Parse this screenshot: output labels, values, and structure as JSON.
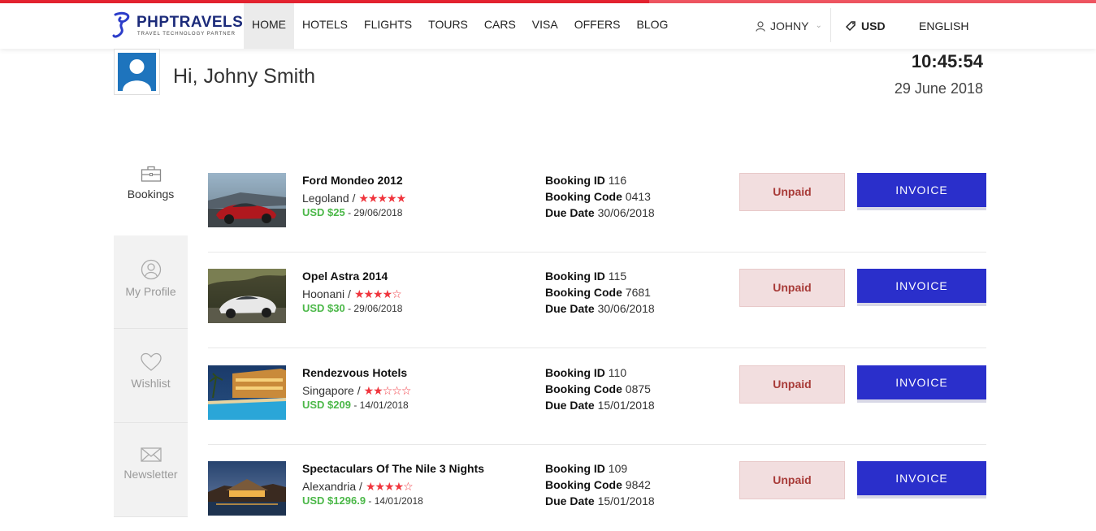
{
  "brand": {
    "name": "PHPTRAVELS",
    "tagline": "TRAVEL TECHNOLOGY PARTNER",
    "accent_color": "#e42330",
    "primary_color": "#2a2fcb"
  },
  "nav": {
    "items": [
      {
        "label": "HOME",
        "active": true
      },
      {
        "label": "HOTELS"
      },
      {
        "label": "FLIGHTS"
      },
      {
        "label": "TOURS"
      },
      {
        "label": "CARS"
      },
      {
        "label": "VISA"
      },
      {
        "label": "OFFERS"
      },
      {
        "label": "BLOG"
      }
    ]
  },
  "user_menu": {
    "label": "JOHNY",
    "icon": "user-icon"
  },
  "currency": {
    "label": "USD",
    "icon": "tag-icon"
  },
  "language": {
    "label": "ENGLISH",
    "icon": "us-flag-icon"
  },
  "profile": {
    "greeting": "Hi, Johny Smith",
    "time": "10:45:54",
    "date": "29 June 2018"
  },
  "sidebar": {
    "items": [
      {
        "label": "Bookings",
        "icon": "briefcase-icon",
        "active": true
      },
      {
        "label": "My Profile",
        "icon": "user-circle-icon"
      },
      {
        "label": "Wishlist",
        "icon": "heart-icon"
      },
      {
        "label": "Newsletter",
        "icon": "envelope-icon"
      }
    ]
  },
  "bookings": [
    {
      "title": "Ford Mondeo 2012",
      "location": "Legoland /",
      "stars": "★★★★★",
      "price": "USD $25",
      "date": "- 29/06/2018",
      "booking_id_label": "Booking ID",
      "booking_id": "116",
      "booking_code_label": "Booking Code",
      "booking_code": "0413",
      "due_date_label": "Due Date",
      "due_date": "30/06/2018",
      "status": "Unpaid",
      "action": "INVOICE"
    },
    {
      "title": "Opel Astra 2014",
      "location": "Hoonani /",
      "stars": "★★★★☆",
      "price": "USD $30",
      "date": "- 29/06/2018",
      "booking_id_label": "Booking ID",
      "booking_id": "115",
      "booking_code_label": "Booking Code",
      "booking_code": "7681",
      "due_date_label": "Due Date",
      "due_date": "30/06/2018",
      "status": "Unpaid",
      "action": "INVOICE"
    },
    {
      "title": "Rendezvous Hotels",
      "location": "Singapore /",
      "stars": "★★☆☆☆",
      "price": "USD $209",
      "date": "- 14/01/2018",
      "booking_id_label": "Booking ID",
      "booking_id": "110",
      "booking_code_label": "Booking Code",
      "booking_code": "0875",
      "due_date_label": "Due Date",
      "due_date": "15/01/2018",
      "status": "Unpaid",
      "action": "INVOICE"
    },
    {
      "title": "Spectaculars Of The Nile 3 Nights",
      "location": "Alexandria /",
      "stars": "★★★★☆",
      "price": "USD $1296.9",
      "date": "- 14/01/2018",
      "booking_id_label": "Booking ID",
      "booking_id": "109",
      "booking_code_label": "Booking Code",
      "booking_code": "9842",
      "due_date_label": "Due Date",
      "due_date": "15/01/2018",
      "status": "Unpaid",
      "action": "INVOICE"
    }
  ]
}
